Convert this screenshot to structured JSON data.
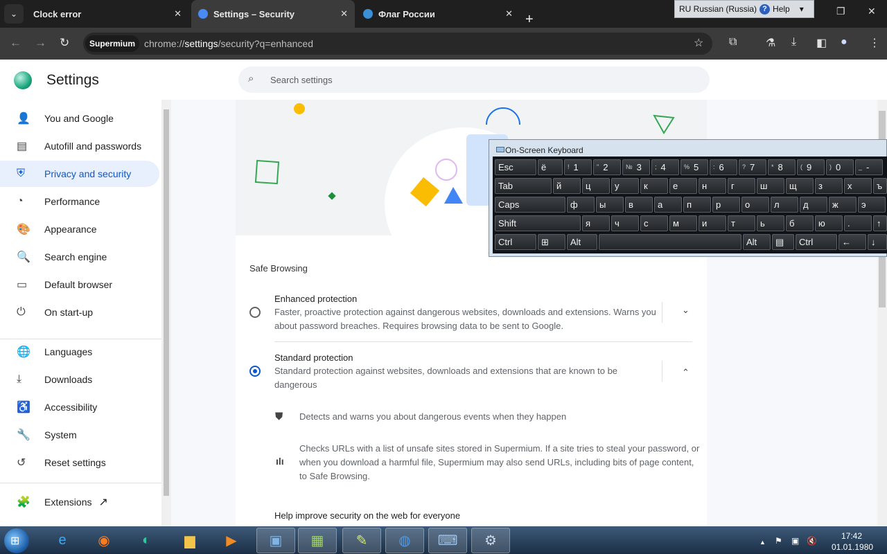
{
  "tabs": [
    {
      "title": "Clock error",
      "close": "✕"
    },
    {
      "title": "Settings – Security",
      "close": "✕"
    },
    {
      "title": "Флаг России",
      "close": "✕"
    }
  ],
  "new_tab": "+",
  "language_bar": {
    "language": "RU Russian (Russia)",
    "help": "Help",
    "help_glyph": "?"
  },
  "window_controls": {
    "minimize": "—",
    "restore": "❐",
    "close": "✕"
  },
  "toolbar": {
    "back": "←",
    "forward": "→",
    "reload": "↻",
    "chip": "Supermium",
    "url_prefix": "chrome://",
    "url_host": "settings",
    "url_rest": "/security?q=enhanced",
    "star": "☆",
    "extensions": "⧉",
    "labs": "⚗",
    "download": "⤓",
    "sidepanel": "◧",
    "profile": "●",
    "menu": "⋮"
  },
  "settings": {
    "title": "Settings",
    "search_placeholder": "Search settings"
  },
  "sidebar": {
    "items": [
      {
        "label": "You and Google",
        "icon": "person-icon",
        "glyph": "👤"
      },
      {
        "label": "Autofill and passwords",
        "icon": "clipboard-icon",
        "glyph": "▤"
      },
      {
        "label": "Privacy and security",
        "icon": "shield-icon",
        "glyph": "⛨"
      },
      {
        "label": "Performance",
        "icon": "speedometer-icon",
        "glyph": "◔"
      },
      {
        "label": "Appearance",
        "icon": "palette-icon",
        "glyph": "🎨"
      },
      {
        "label": "Search engine",
        "icon": "search-icon",
        "glyph": "🔍"
      },
      {
        "label": "Default browser",
        "icon": "browser-icon",
        "glyph": "▭"
      },
      {
        "label": "On start-up",
        "icon": "power-icon",
        "glyph": "⏻"
      },
      {
        "label": "Languages",
        "icon": "globe-icon",
        "glyph": "🌐"
      },
      {
        "label": "Downloads",
        "icon": "download-icon",
        "glyph": "⤓"
      },
      {
        "label": "Accessibility",
        "icon": "accessibility-icon",
        "glyph": "♿"
      },
      {
        "label": "System",
        "icon": "wrench-icon",
        "glyph": "🔧"
      },
      {
        "label": "Reset settings",
        "icon": "history-icon",
        "glyph": "↺"
      },
      {
        "label": "Extensions",
        "icon": "puzzle-icon",
        "glyph": "🧩"
      }
    ],
    "external_link": "↗"
  },
  "main": {
    "section_title": "Safe Browsing",
    "enhanced": {
      "title": "Enhanced protection",
      "desc_line1": "Faster, proactive protection against dangerous websites, downloads and extensions. Warns you",
      "desc_line2": "about password breaches. Requires browsing data to be sent to Google.",
      "selected": false
    },
    "standard": {
      "title": "Standard protection",
      "desc_line1": "Standard protection against websites, downloads and extensions that are known to be",
      "desc_line2": "dangerous",
      "selected": true
    },
    "details": [
      {
        "text": "Detects and warns you about dangerous events when they happen",
        "icon": "shield-half-icon"
      },
      {
        "line1": "Checks URLs with a list of unsafe sites stored in Supermium. If a site tries to steal your password, or",
        "line2": "when you download a harmful file, Supermium may also send URLs, including bits of page content,",
        "line3": "to Safe Browsing.",
        "icon": "bar-chart-icon"
      }
    ],
    "help_improve": "Help improve security on the web for everyone",
    "chevron_down": "⌄",
    "chevron_up": "⌃"
  },
  "osk": {
    "title": "On-Screen Keyboard",
    "rows": [
      [
        {
          "k": "Esc"
        },
        {
          "k": "ё"
        },
        {
          "s": "!",
          "k": "1"
        },
        {
          "s": "\"",
          "k": "2"
        },
        {
          "s": "№",
          "k": "3"
        },
        {
          "s": ";",
          "k": "4"
        },
        {
          "s": "%",
          "k": "5"
        },
        {
          "s": ":",
          "k": "6"
        },
        {
          "s": "?",
          "k": "7"
        },
        {
          "s": "*",
          "k": "8"
        },
        {
          "s": "(",
          "k": "9"
        },
        {
          "s": ")",
          "k": "0"
        },
        {
          "s": "_",
          "k": "-"
        }
      ],
      [
        {
          "k": "Tab"
        },
        {
          "k": "й"
        },
        {
          "k": "ц"
        },
        {
          "k": "у"
        },
        {
          "k": "к"
        },
        {
          "k": "е"
        },
        {
          "k": "н"
        },
        {
          "k": "г"
        },
        {
          "k": "ш"
        },
        {
          "k": "щ"
        },
        {
          "k": "з"
        },
        {
          "k": "х"
        },
        {
          "k": "ъ"
        }
      ],
      [
        {
          "k": "Caps"
        },
        {
          "k": "ф"
        },
        {
          "k": "ы"
        },
        {
          "k": "в"
        },
        {
          "k": "а"
        },
        {
          "k": "п"
        },
        {
          "k": "р"
        },
        {
          "k": "о"
        },
        {
          "k": "л"
        },
        {
          "k": "д"
        },
        {
          "k": "ж"
        },
        {
          "k": "э"
        }
      ],
      [
        {
          "k": "Shift"
        },
        {
          "k": "я"
        },
        {
          "k": "ч"
        },
        {
          "k": "с"
        },
        {
          "k": "м"
        },
        {
          "k": "и"
        },
        {
          "k": "т"
        },
        {
          "k": "ь"
        },
        {
          "k": "б"
        },
        {
          "k": "ю"
        },
        {
          "k": "."
        },
        {
          "k": "↑"
        }
      ],
      [
        {
          "k": "Ctrl"
        },
        {
          "k": "⊞"
        },
        {
          "k": "Alt"
        },
        {
          "k": ""
        },
        {
          "k": "Alt"
        },
        {
          "k": "▤"
        },
        {
          "k": "Ctrl"
        },
        {
          "k": "←"
        },
        {
          "k": "↓"
        }
      ]
    ]
  },
  "taskbar": {
    "apps": [
      {
        "name": "ie-icon",
        "glyph": "e",
        "color": "#3fa9f5"
      },
      {
        "name": "firefox-icon",
        "glyph": "◉",
        "color": "#ff7a1a"
      },
      {
        "name": "supermium-icon",
        "glyph": "◐",
        "color": "#2cc9a0"
      },
      {
        "name": "explorer-icon",
        "glyph": "▆",
        "color": "#f3c44a"
      },
      {
        "name": "media-player-icon",
        "glyph": "▶",
        "color": "#f08a24"
      },
      {
        "name": "photo-viewer-icon",
        "glyph": "▣",
        "color": "#7fb4e6"
      },
      {
        "name": "control-panel-icon",
        "glyph": "▦",
        "color": "#9fd06b"
      },
      {
        "name": "graph-icon",
        "glyph": "✎",
        "color": "#cfe872"
      },
      {
        "name": "globe-clock-icon",
        "glyph": "◍",
        "color": "#4f9be8"
      },
      {
        "name": "keyboard-app-icon",
        "glyph": "⌨",
        "color": "#9cc2e8"
      },
      {
        "name": "settings-app-icon",
        "glyph": "⚙",
        "color": "#c9d7e6"
      }
    ],
    "tray_up": "▲",
    "tray_flag": "⚑",
    "tray_net": "▣",
    "tray_sound": "🔇",
    "time": "17:42",
    "date": "01.01.1980"
  }
}
